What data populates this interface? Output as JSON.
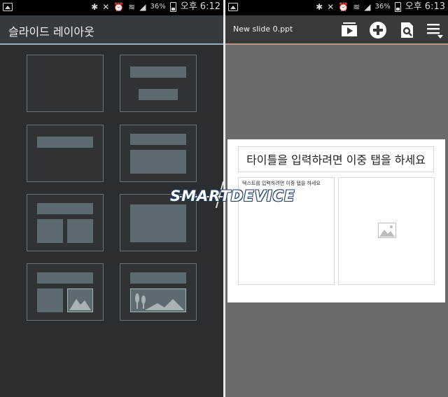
{
  "status_left": {
    "battery_pct": "36%",
    "clock": "오후 6:12"
  },
  "status_right": {
    "battery_pct": "36%",
    "clock": "오후 6:13"
  },
  "left_panel": {
    "title": "슬라이드 레이아웃"
  },
  "right_panel": {
    "filename": "New slide 0.ppt",
    "toolbar": [
      "slideshow-icon",
      "add-icon",
      "search-document-icon",
      "menu-icon"
    ],
    "slide": {
      "title_placeholder": "타이틀을 입력하려면 이중 탭을 하세요",
      "text_placeholder": "텍스트를 입력하려면 이중 탭을 하세요"
    }
  },
  "watermark": "SMARTDEVICE",
  "colors": {
    "left_bg": "#2b2e31",
    "right_bg": "#6b6b6b",
    "left_accent": "#8fb2c9",
    "right_accent": "#c9917a",
    "block": "#5d6a6f"
  }
}
